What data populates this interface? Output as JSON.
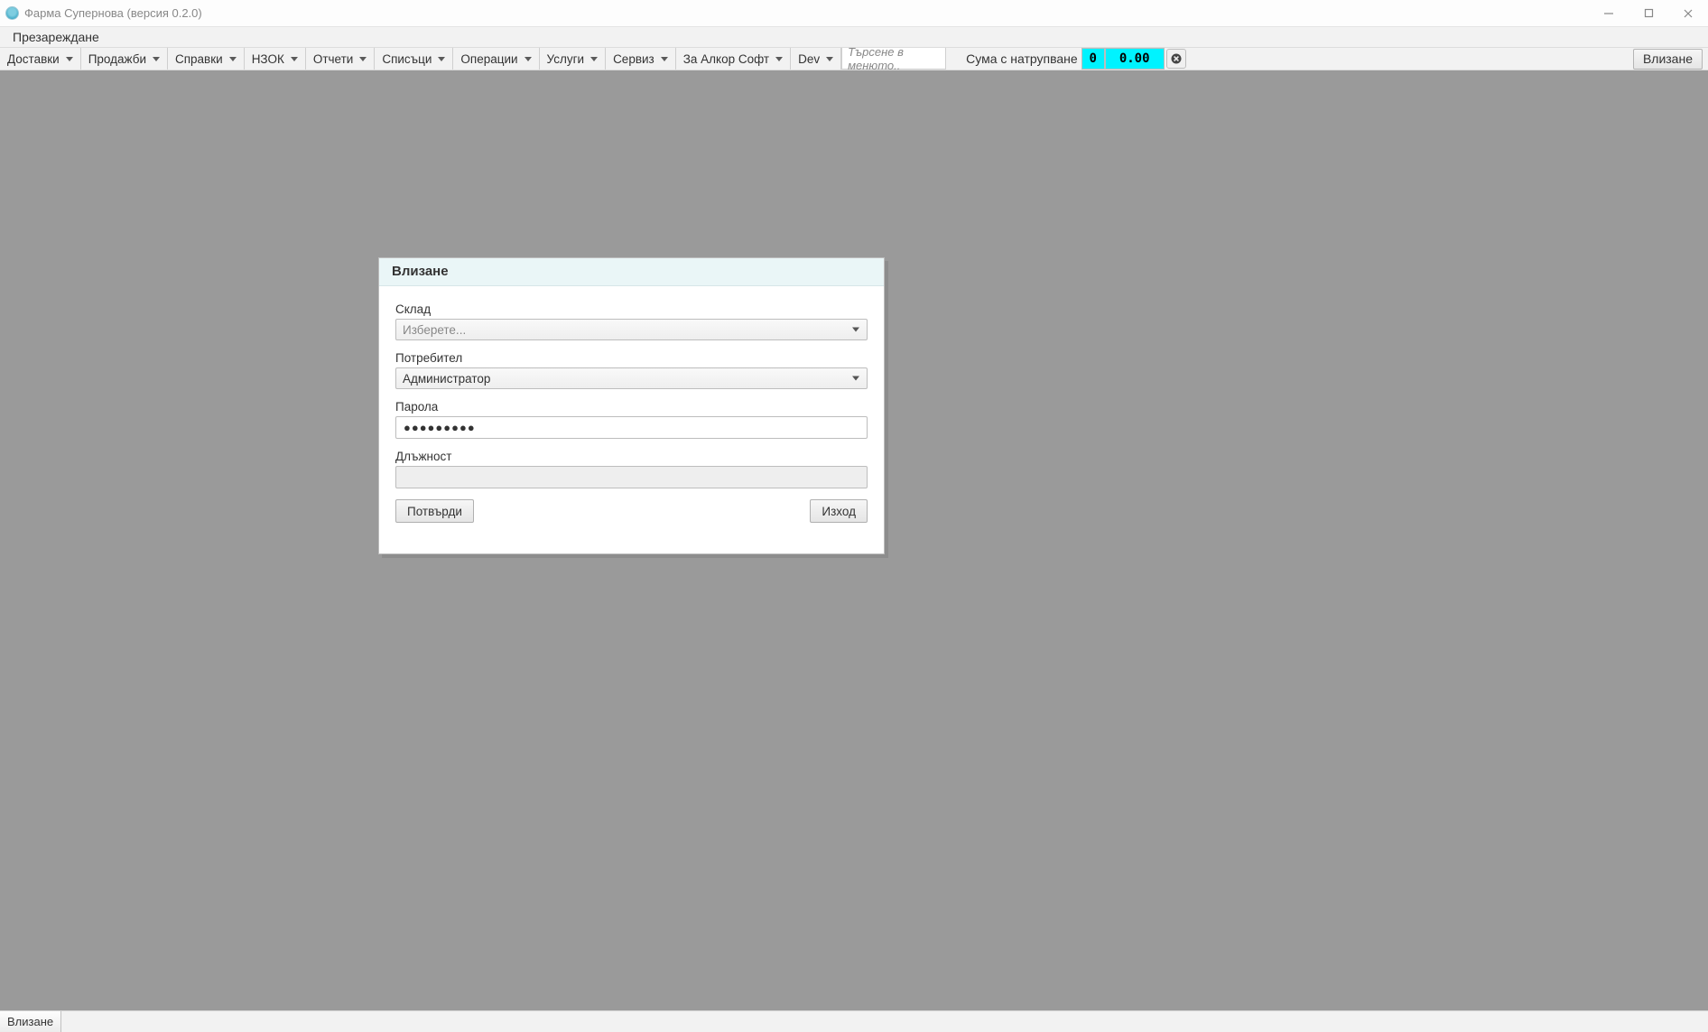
{
  "window": {
    "title": "Фарма Супернова (версия 0.2.0)"
  },
  "menubar": {
    "reload": "Презареждане"
  },
  "toolbar": {
    "items": [
      "Доставки",
      "Продажби",
      "Справки",
      "НЗОК",
      "Отчети",
      "Списъци",
      "Операции",
      "Услуги",
      "Сервиз",
      "За Алкор Софт",
      "Dev"
    ],
    "search_placeholder": "Търсене в менюто..",
    "sum_label": "Сума с натрупване",
    "sum_count": "0",
    "sum_value": "0.00",
    "login_label": "Влизане"
  },
  "dialog": {
    "title": "Влизане",
    "fields": {
      "warehouse_label": "Склад",
      "warehouse_placeholder": "Изберете...",
      "user_label": "Потребител",
      "user_value": "Администратор",
      "password_label": "Парола",
      "password_value": "●●●●●●●●●",
      "position_label": "Длъжност",
      "position_value": ""
    },
    "buttons": {
      "confirm": "Потвърди",
      "exit": "Изход"
    }
  },
  "statusbar": {
    "tab": "Влизане"
  }
}
